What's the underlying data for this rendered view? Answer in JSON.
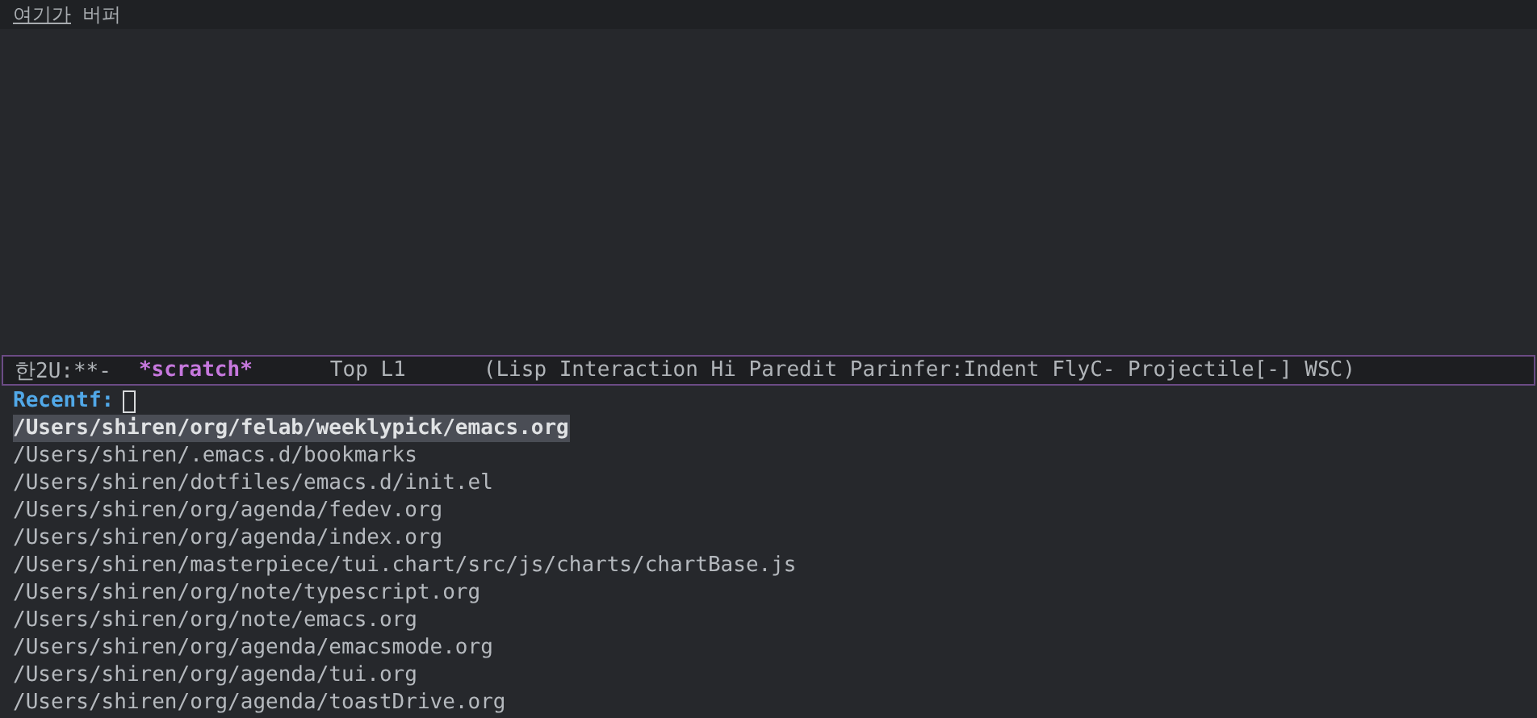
{
  "header_line": [
    {
      "text": "여기가",
      "underlined": true
    },
    {
      "text": "버퍼",
      "underlined": false
    }
  ],
  "mode_line": {
    "status": "한2U:**-",
    "buffer_name": "*scratch*",
    "position": "Top L1",
    "modes": "(Lisp Interaction Hi Paredit Parinfer:Indent FlyC- Projectile[-] WSC)"
  },
  "minibuffer": {
    "prompt": "Recentf:",
    "candidates": [
      {
        "path": "/Users/shiren/org/felab/weeklypick/emacs.org",
        "selected": true
      },
      {
        "path": "/Users/shiren/.emacs.d/bookmarks",
        "selected": false
      },
      {
        "path": "/Users/shiren/dotfiles/emacs.d/init.el",
        "selected": false
      },
      {
        "path": "/Users/shiren/org/agenda/fedev.org",
        "selected": false
      },
      {
        "path": "/Users/shiren/org/agenda/index.org",
        "selected": false
      },
      {
        "path": "/Users/shiren/masterpiece/tui.chart/src/js/charts/chartBase.js",
        "selected": false
      },
      {
        "path": "/Users/shiren/org/note/typescript.org",
        "selected": false
      },
      {
        "path": "/Users/shiren/org/note/emacs.org",
        "selected": false
      },
      {
        "path": "/Users/shiren/org/agenda/emacsmode.org",
        "selected": false
      },
      {
        "path": "/Users/shiren/org/agenda/tui.org",
        "selected": false
      },
      {
        "path": "/Users/shiren/org/agenda/toastDrive.org",
        "selected": false
      }
    ]
  }
}
